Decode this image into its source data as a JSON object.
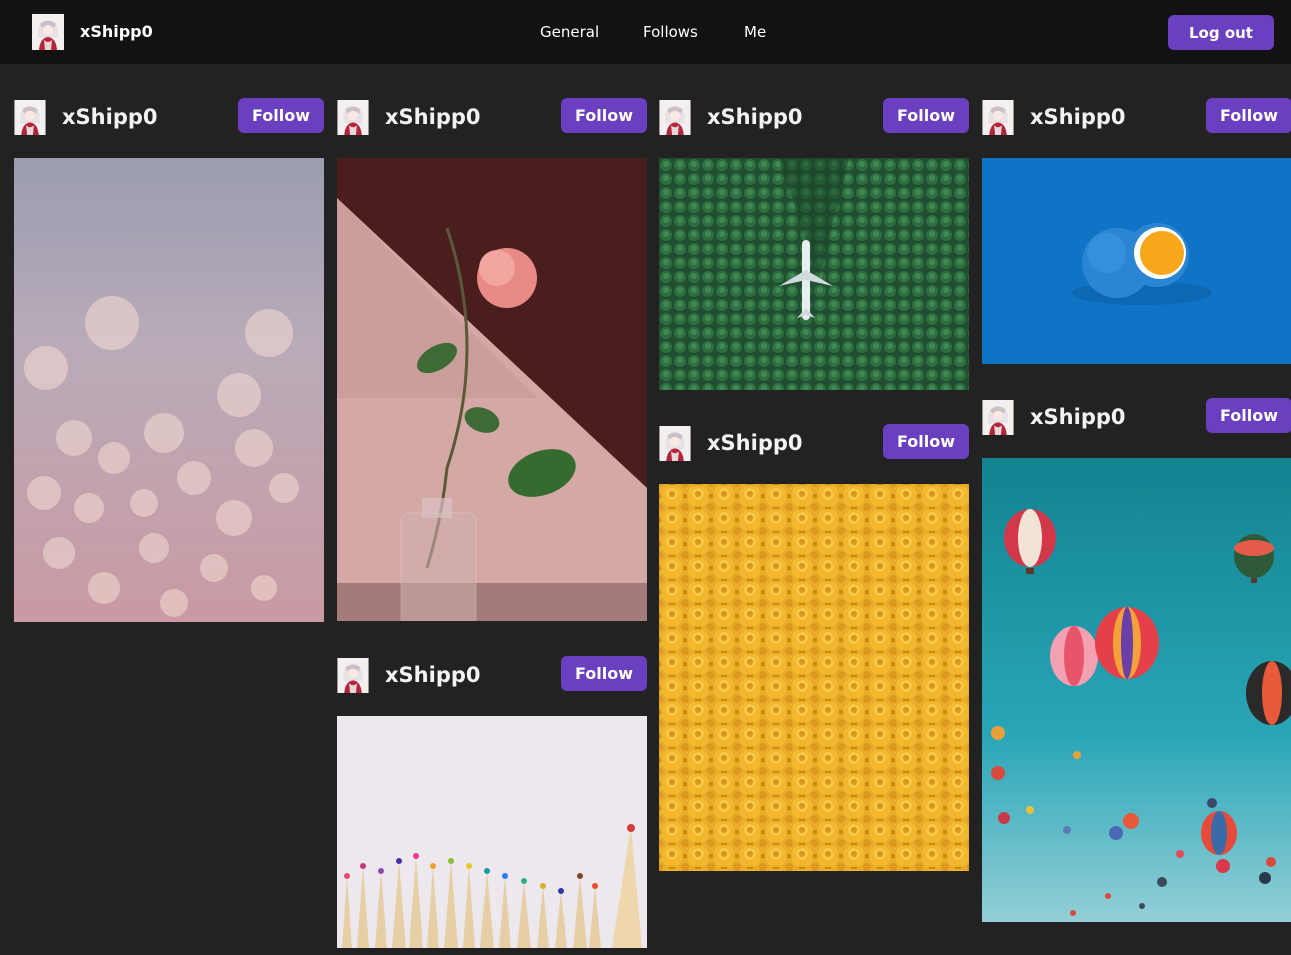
{
  "header": {
    "username": "xShipp0",
    "nav": [
      "General",
      "Follows",
      "Me"
    ],
    "logout_label": "Log out"
  },
  "posts": [
    {
      "username": "xShipp0",
      "follow_label": "Follow",
      "photo": "bokeh-lights-photo"
    },
    {
      "username": "xShipp0",
      "follow_label": "Follow",
      "photo": "rose-in-vase-photo"
    },
    {
      "username": "xShipp0",
      "follow_label": "Follow",
      "photo": "colored-pencils-photo"
    },
    {
      "username": "xShipp0",
      "follow_label": "Follow",
      "photo": "airplane-in-forest-photo"
    },
    {
      "username": "xShipp0",
      "follow_label": "Follow",
      "photo": "lego-heads-photo"
    },
    {
      "username": "xShipp0",
      "follow_label": "Follow",
      "photo": "blue-orange-photo"
    },
    {
      "username": "xShipp0",
      "follow_label": "Follow",
      "photo": "hot-air-balloons-photo"
    }
  ],
  "colors": {
    "accent": "#6a3fc0",
    "topbar": "#121212",
    "background": "#222222"
  }
}
